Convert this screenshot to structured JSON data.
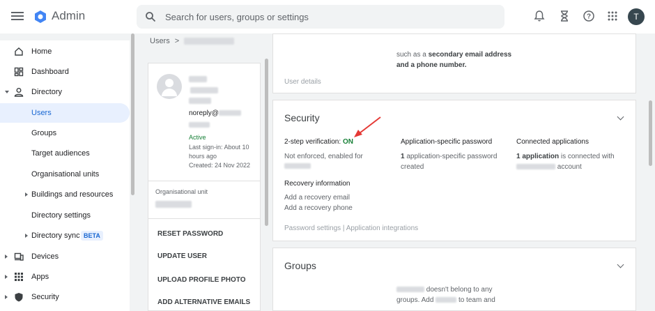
{
  "app": {
    "title": "Admin",
    "avatar_initial": "T"
  },
  "search": {
    "placeholder": "Search for users, groups or settings"
  },
  "topbar_icons": [
    "bell-icon",
    "hourglass-icon",
    "help-icon",
    "apps-grid-icon"
  ],
  "sidebar": {
    "items": [
      {
        "label": "Home",
        "icon": "home-icon"
      },
      {
        "label": "Dashboard",
        "icon": "dashboard-icon"
      },
      {
        "label": "Directory",
        "icon": "person-icon",
        "expanded": true
      },
      {
        "label": "Users",
        "active": true
      },
      {
        "label": "Groups"
      },
      {
        "label": "Target audiences"
      },
      {
        "label": "Organisational units"
      },
      {
        "label": "Buildings and resources",
        "collapsible": true
      },
      {
        "label": "Directory settings"
      },
      {
        "label": "Directory sync",
        "badge": "BETA",
        "collapsible": true
      },
      {
        "label": "Devices",
        "icon": "devices-icon"
      },
      {
        "label": "Apps",
        "icon": "apps-icon"
      },
      {
        "label": "Security",
        "icon": "shield-icon"
      }
    ]
  },
  "breadcrumb": {
    "root": "Users",
    "separator": ">"
  },
  "user_card": {
    "email_prefix": "noreply@",
    "status": "Active",
    "last_signin_1": "Last sign-in: About 10",
    "last_signin_2": "hours ago",
    "created": "Created: 24 Nov 2022",
    "ou_label": "Organisational unit",
    "actions": [
      "RESET PASSWORD",
      "UPDATE USER",
      "UPLOAD PROFILE PHOTO",
      "ADD ALTERNATIVE EMAILS"
    ]
  },
  "user_details": {
    "line1_prefix": "such as a ",
    "line1_bold": "secondary email address",
    "line2": "and a phone number.",
    "footer": "User details"
  },
  "security": {
    "title": "Security",
    "two_step_label": "2-step verification:",
    "two_step_value": "ON",
    "two_step_desc": "Not enforced, enabled for",
    "app_password_title": "Application-specific password",
    "app_password_count": "1",
    "app_password_desc1": "application-specific password",
    "app_password_desc2": "created",
    "connected_title": "Connected applications",
    "connected_bold": "1 application",
    "connected_desc1": "is connected with",
    "connected_desc2": "account",
    "recovery_title": "Recovery information",
    "recovery_email": "Add a recovery email",
    "recovery_phone": "Add a recovery phone",
    "links": "Password settings | Application integrations"
  },
  "groups": {
    "title": "Groups",
    "line1": "doesn't belong to any",
    "line2_a": "groups. Add",
    "line2_b": "to team and"
  },
  "colors": {
    "accent": "#1967d2",
    "success": "#188038",
    "annotation_arrow": "#e53935"
  }
}
